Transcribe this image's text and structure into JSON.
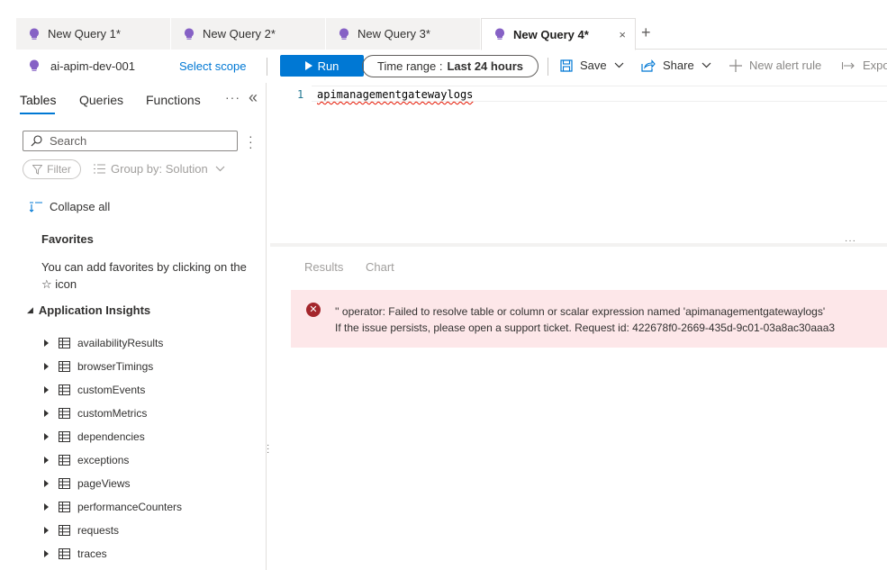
{
  "tabs": [
    {
      "label": "New Query 1*"
    },
    {
      "label": "New Query 2*"
    },
    {
      "label": "New Query 3*"
    },
    {
      "label": "New Query 4*",
      "close": "×"
    }
  ],
  "new_tab": "+",
  "toolbar": {
    "scope_name": "ai-apim-dev-001",
    "select_scope": "Select scope",
    "run": "Run",
    "time_range_label": "Time range :",
    "time_range_value": "Last 24 hours",
    "save": "Save",
    "share": "Share",
    "new_alert_rule": "New alert rule",
    "export": "Expo"
  },
  "left_panel": {
    "tabs": [
      "Tables",
      "Queries",
      "Functions"
    ],
    "more": "···",
    "collapse": "«",
    "search_placeholder": "Search",
    "filter": "Filter",
    "group_by": "Group by: Solution",
    "collapse_all": "Collapse all",
    "favorites_title": "Favorites",
    "favorites_desc": "You can add favorites by clicking on the ☆ icon",
    "section_title": "Application Insights",
    "tables": [
      "availabilityResults",
      "browserTimings",
      "customEvents",
      "customMetrics",
      "dependencies",
      "exceptions",
      "pageViews",
      "performanceCounters",
      "requests",
      "traces"
    ]
  },
  "editor": {
    "line_number": "1",
    "code": "apimanagementgatewaylogs"
  },
  "results": {
    "tabs": [
      "Results",
      "Chart"
    ],
    "error_line1": "'' operator: Failed to resolve table or column or scalar expression named 'apimanagementgatewaylogs'",
    "error_line2": "If the issue persists, please open a support ticket. Request id: 422678f0-2669-435d-9c01-03a8ac30aaa3"
  },
  "colors": {
    "accent": "#0078d4",
    "error_bg": "#fde7e9",
    "error_icon": "#a4262c",
    "bulb": "#8661c5"
  }
}
